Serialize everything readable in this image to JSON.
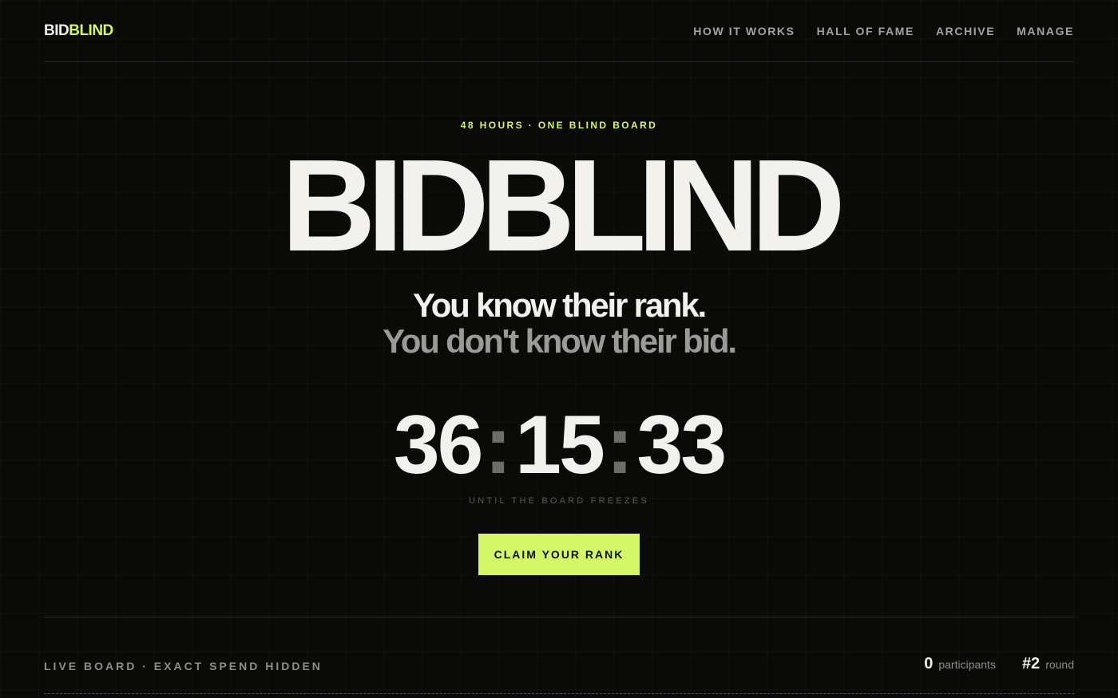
{
  "header": {
    "logo_part1": "BID",
    "logo_part2": "BLIND",
    "nav": [
      "HOW IT WORKS",
      "HALL OF FAME",
      "ARCHIVE",
      "MANAGE"
    ]
  },
  "hero": {
    "eyebrow": "48 HOURS · ONE BLIND BOARD",
    "title": "BIDBLIND",
    "tagline_line1": "You know their rank.",
    "tagline_line2": "You don't know their bid."
  },
  "countdown": {
    "hours": "36",
    "minutes": "15",
    "seconds": "33",
    "separator": ":",
    "label": "UNTIL THE BOARD FREEZES"
  },
  "cta": {
    "label": "CLAIM YOUR RANK"
  },
  "board": {
    "label": "LIVE BOARD · EXACT SPEND HIDDEN",
    "participants_value": "0",
    "participants_unit": "participants",
    "round_value": "#2",
    "round_unit": "round"
  },
  "colors": {
    "accent": "#d4f76a",
    "background": "#0a0a09",
    "text": "#f2f1ec",
    "muted": "#9b9a95"
  }
}
